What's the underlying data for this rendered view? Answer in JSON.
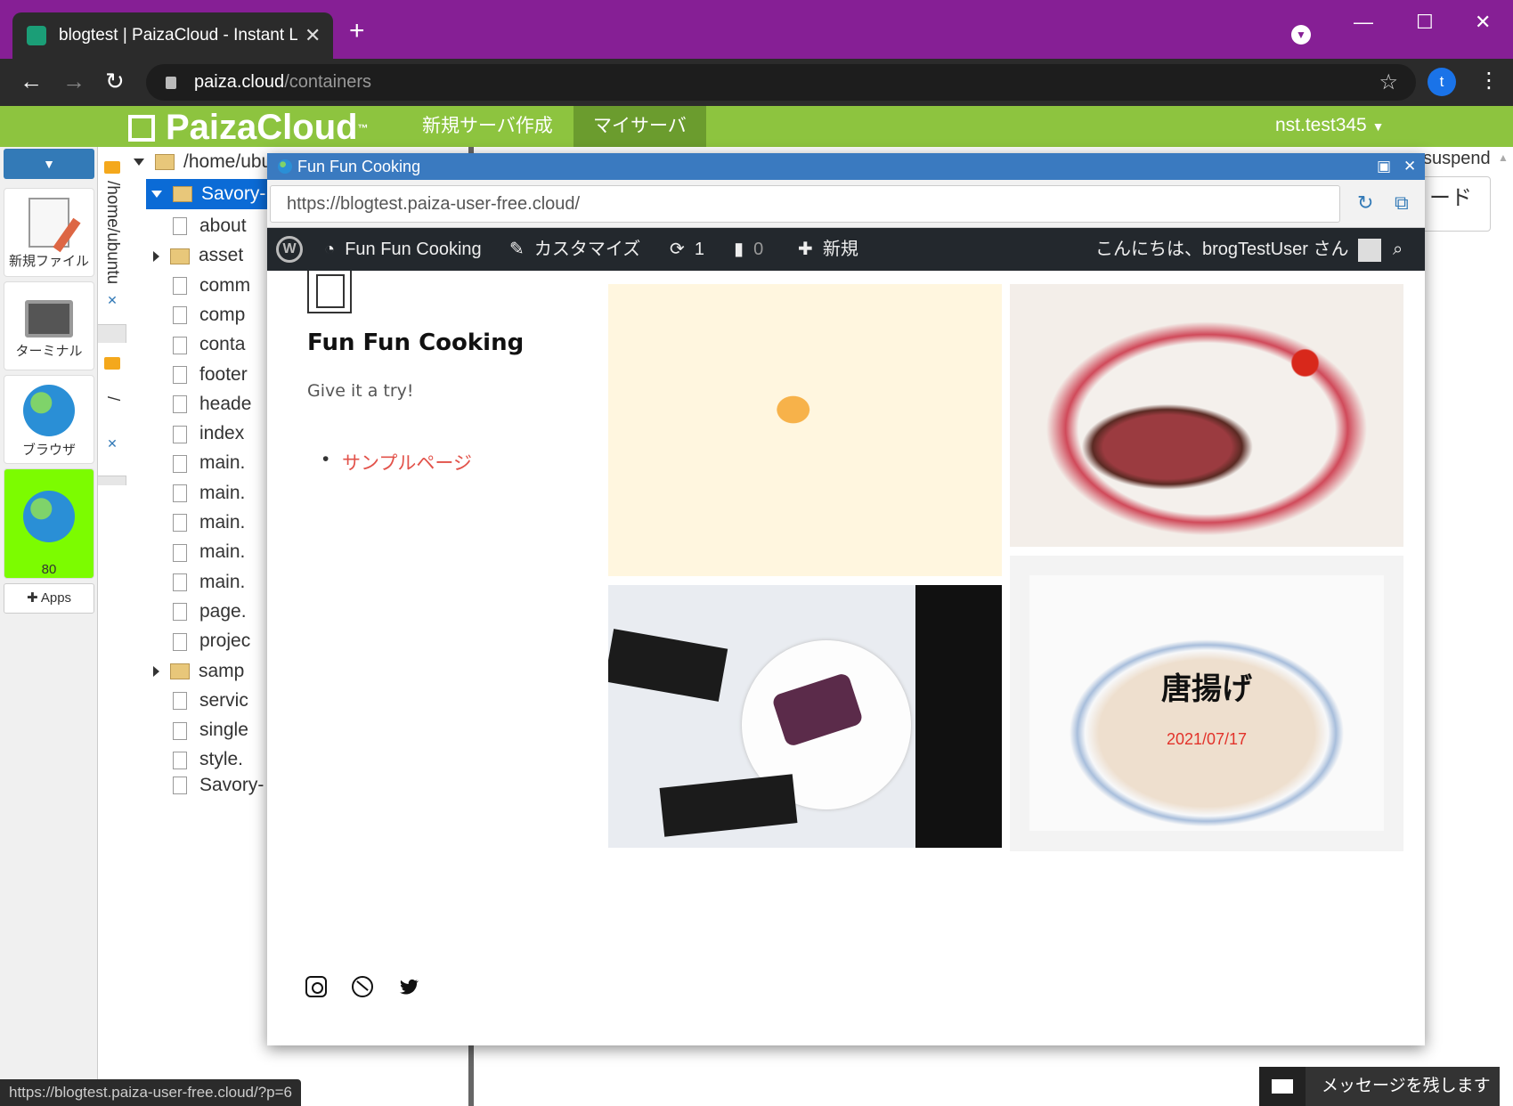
{
  "window": {
    "tab_title": "blogtest | PaizaCloud - Instant Li",
    "new_tab": "+",
    "url_host": "paiza.cloud",
    "url_path": "/containers",
    "profile_initial": "t"
  },
  "paiza": {
    "logo": "PaizaCloud",
    "logo_tm": "™",
    "nav_new_server": "新規サーバ作成",
    "nav_my_server": "マイサーバ",
    "user": "nst.test345",
    "suspend": "suspend",
    "download_fragment": "ード"
  },
  "dock": {
    "new_file": "新規ファイル",
    "terminal": "ターミナル",
    "browser": "ブラウザ",
    "port": "80",
    "apps": "Apps"
  },
  "vtabs": [
    {
      "label": "/home/ubuntu"
    },
    {
      "label": "/"
    }
  ],
  "filetree": {
    "root": "/home/ubu",
    "selected": "Savory-",
    "items": [
      "about",
      "asset",
      "comm",
      "comp",
      "conta",
      "footer",
      "heade",
      "index",
      "main.",
      "main.",
      "main.",
      "main.",
      "main.",
      "page.",
      "projec",
      "samp",
      "servic",
      "single",
      "style."
    ],
    "bottom": "Savory-"
  },
  "modal": {
    "title": "Fun Fun Cooking",
    "url": "https://blogtest.paiza-user-free.cloud/"
  },
  "wpbar": {
    "site": "Fun Fun Cooking",
    "customize": "カスタマイズ",
    "updates": "1",
    "comments": "0",
    "new": "新規",
    "greeting": "こんにちは、brogTestUser さん"
  },
  "site": {
    "title": "Fun Fun Cooking",
    "tagline": "Give it a try!",
    "menu_item": "サンプルページ",
    "featured_title": "唐揚げ",
    "featured_date": "2021/07/17"
  },
  "status_url": "https://blogtest.paiza-user-free.cloud/?p=6",
  "chat": "メッセージを残します"
}
